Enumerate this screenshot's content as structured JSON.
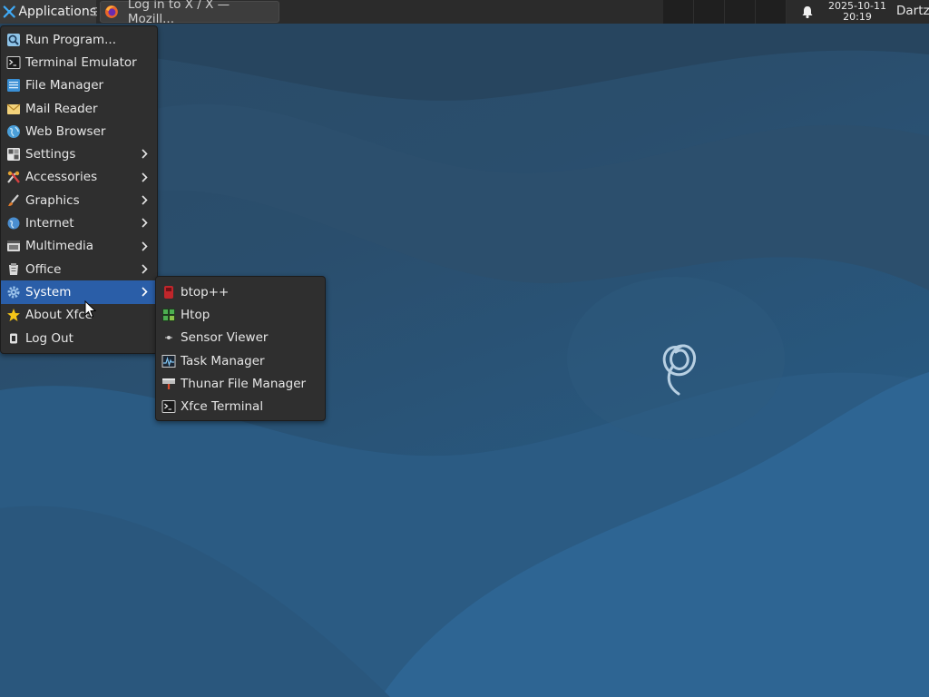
{
  "panel": {
    "applications_label": "Applications",
    "window_button_label": "Log in to X / X — Mozill...",
    "clock_date": "2025-10-11",
    "clock_time": "20:19",
    "user_label": "Dartz"
  },
  "menu": {
    "items": [
      {
        "label": "Run Program...",
        "icon": "search-icon"
      },
      {
        "label": "Terminal Emulator",
        "icon": "terminal-icon"
      },
      {
        "label": "File Manager",
        "icon": "file-manager-icon"
      },
      {
        "label": "Mail Reader",
        "icon": "mail-icon"
      },
      {
        "label": "Web Browser",
        "icon": "globe-icon"
      },
      {
        "label": "Settings",
        "icon": "settings-icon",
        "submenu": true
      },
      {
        "label": "Accessories",
        "icon": "accessories-icon",
        "submenu": true
      },
      {
        "label": "Graphics",
        "icon": "graphics-icon",
        "submenu": true
      },
      {
        "label": "Internet",
        "icon": "internet-icon",
        "submenu": true
      },
      {
        "label": "Multimedia",
        "icon": "multimedia-icon",
        "submenu": true
      },
      {
        "label": "Office",
        "icon": "office-icon",
        "submenu": true
      },
      {
        "label": "System",
        "icon": "system-gear-icon",
        "submenu": true,
        "active": true
      },
      {
        "label": "About Xfce",
        "icon": "star-icon"
      },
      {
        "label": "Log Out",
        "icon": "logout-icon"
      }
    ]
  },
  "submenu": {
    "parent": "System",
    "items": [
      {
        "label": "btop++",
        "icon": "btop-icon"
      },
      {
        "label": "Htop",
        "icon": "htop-icon"
      },
      {
        "label": "Sensor Viewer",
        "icon": "sensor-icon"
      },
      {
        "label": "Task Manager",
        "icon": "task-manager-icon"
      },
      {
        "label": "Thunar File Manager",
        "icon": "thunar-icon"
      },
      {
        "label": "Xfce Terminal",
        "icon": "terminal-icon"
      }
    ]
  },
  "colors": {
    "panel_bg": "#2b2b2b",
    "menu_bg": "#2f2f2f",
    "highlight": "#2a5ea8",
    "wallpaper": "#2a5275"
  }
}
